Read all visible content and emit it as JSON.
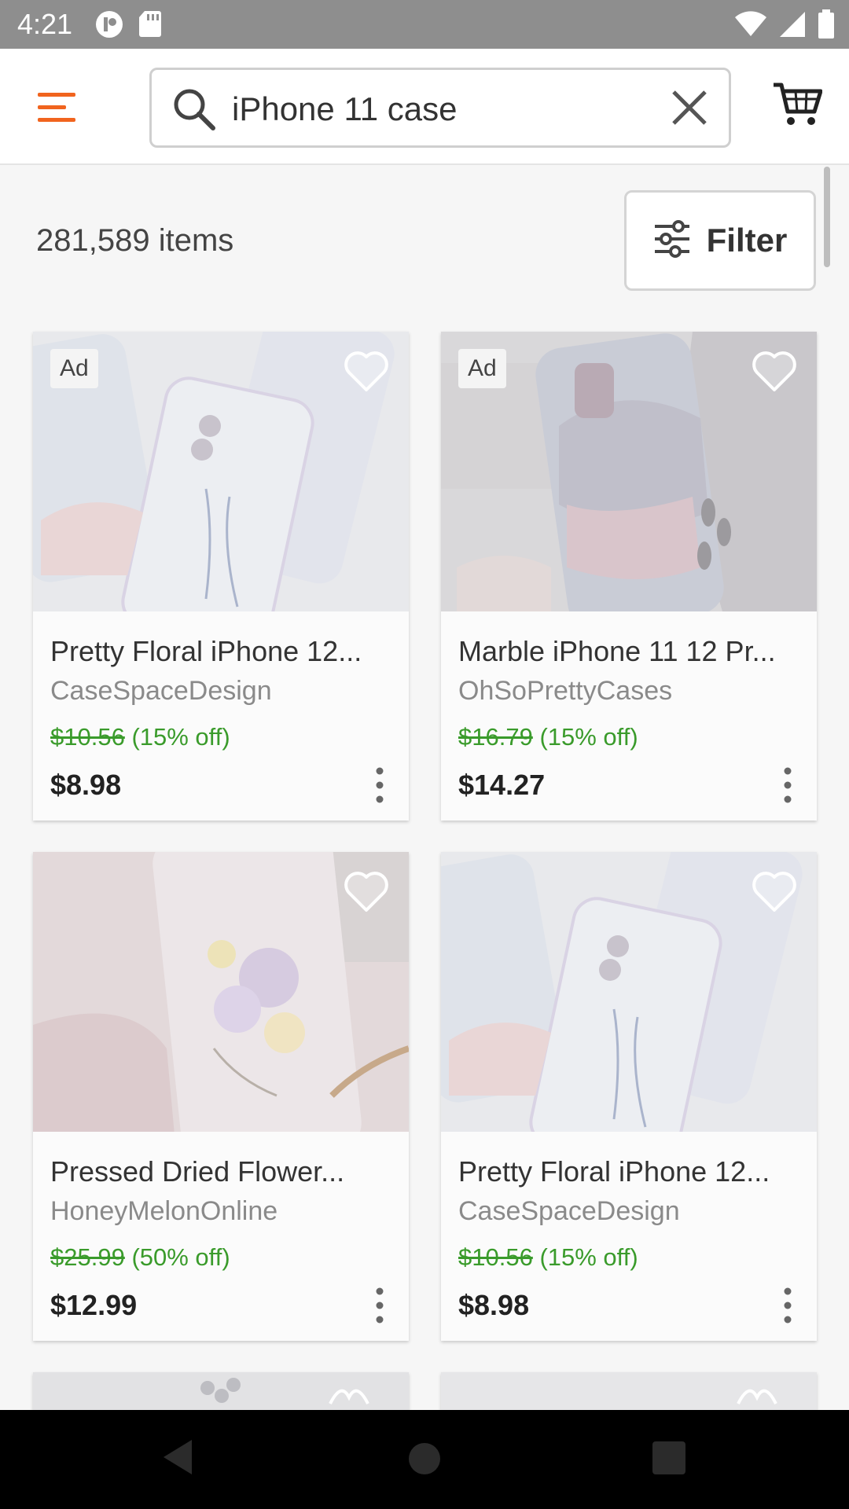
{
  "status_bar": {
    "time": "4:21",
    "icons": [
      "notification-icon",
      "sd-card-icon",
      "wifi-icon",
      "signal-icon",
      "battery-icon"
    ]
  },
  "header": {
    "menu_icon": "hamburger-menu-icon",
    "search_value": "iPhone 11 case",
    "search_icon": "search-icon",
    "clear_icon": "close-icon",
    "cart_icon": "cart-icon",
    "accent_color": "#f1641e"
  },
  "results": {
    "count_text": "281,589 items",
    "filter_label": "Filter",
    "filter_icon": "sliders-icon"
  },
  "products": [
    {
      "ad_label": "Ad",
      "title": "Pretty Floral iPhone 12...",
      "shop": "CaseSpaceDesign",
      "original_price": "$10.56",
      "discount": "(15% off)",
      "price": "$8.98",
      "image_theme": "floral-clear-cases"
    },
    {
      "ad_label": "Ad",
      "title": "Marble iPhone 11 12 Pr...",
      "shop": "OhSoPrettyCases",
      "original_price": "$16.79",
      "discount": "(15% off)",
      "price": "$14.27",
      "image_theme": "marble-case-in-hand"
    },
    {
      "ad_label": "",
      "title": "Pressed Dried Flower...",
      "shop": "HoneyMelonOnline",
      "original_price": "$25.99",
      "discount": "(50% off)",
      "price": "$12.99",
      "image_theme": "pressed-flower-case"
    },
    {
      "ad_label": "",
      "title": "Pretty Floral iPhone 12...",
      "shop": "CaseSpaceDesign",
      "original_price": "$10.56",
      "discount": "(15% off)",
      "price": "$8.98",
      "image_theme": "floral-clear-cases"
    }
  ],
  "colors": {
    "discount_green": "#3a9b2b",
    "status_bar": "#8e8e8e"
  },
  "nav_bar": {
    "back_icon": "back-triangle-icon",
    "home_icon": "home-circle-icon",
    "recents_icon": "recents-square-icon"
  }
}
